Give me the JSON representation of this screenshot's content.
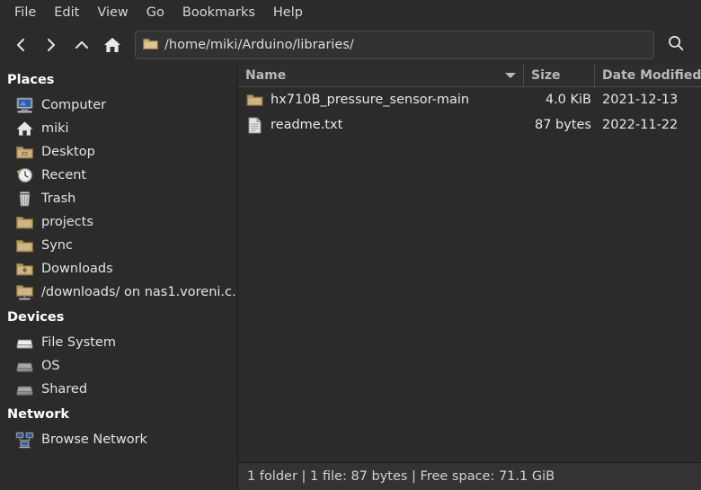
{
  "menubar": {
    "items": [
      {
        "label": "File"
      },
      {
        "label": "Edit"
      },
      {
        "label": "View"
      },
      {
        "label": "Go"
      },
      {
        "label": "Bookmarks"
      },
      {
        "label": "Help"
      }
    ]
  },
  "toolbar": {
    "back_icon": "chevron-left-icon",
    "forward_icon": "chevron-right-icon",
    "up_icon": "chevron-up-icon",
    "home_icon": "home-icon",
    "search_icon": "search-icon",
    "path_icon": "folder-icon",
    "path_value": "/home/miki/Arduino/libraries/"
  },
  "sidebar": {
    "sections": [
      {
        "title": "Places",
        "items": [
          {
            "label": "Computer",
            "icon": "computer-icon"
          },
          {
            "label": "miki",
            "icon": "home-icon"
          },
          {
            "label": "Desktop",
            "icon": "desktop-folder-icon"
          },
          {
            "label": "Recent",
            "icon": "clock-icon"
          },
          {
            "label": "Trash",
            "icon": "trash-icon"
          },
          {
            "label": "projects",
            "icon": "folder-icon"
          },
          {
            "label": "Sync",
            "icon": "folder-icon"
          },
          {
            "label": "Downloads",
            "icon": "downloads-folder-icon"
          },
          {
            "label": "/downloads/ on nas1.voreni.c…",
            "icon": "network-folder-icon"
          }
        ]
      },
      {
        "title": "Devices",
        "items": [
          {
            "label": "File System",
            "icon": "drive-icon"
          },
          {
            "label": "OS",
            "icon": "drive-icon"
          },
          {
            "label": "Shared",
            "icon": "drive-icon"
          }
        ]
      },
      {
        "title": "Network",
        "items": [
          {
            "label": "Browse Network",
            "icon": "network-icon"
          }
        ]
      }
    ]
  },
  "filelist": {
    "columns": [
      {
        "label": "Name",
        "sort": "descending"
      },
      {
        "label": "Size"
      },
      {
        "label": "Date Modified"
      }
    ],
    "rows": [
      {
        "name": "hx710B_pressure_sensor-main",
        "size": "4.0 KiB",
        "date": "2021-12-13",
        "icon": "folder-icon"
      },
      {
        "name": "readme.txt",
        "size": "87 bytes",
        "date": "2022-11-22",
        "icon": "text-file-icon"
      }
    ]
  },
  "statusbar": {
    "text": "1 folder  |  1 file: 87 bytes  |  Free space: 71.1 GiB"
  },
  "colors": {
    "window_bg": "#2b2b2b",
    "statusbar_bg": "#333333",
    "text": "#e3e3e3",
    "heading": "#ffffff",
    "folder": "#c9a96b",
    "accent_blue": "#3465a4"
  }
}
